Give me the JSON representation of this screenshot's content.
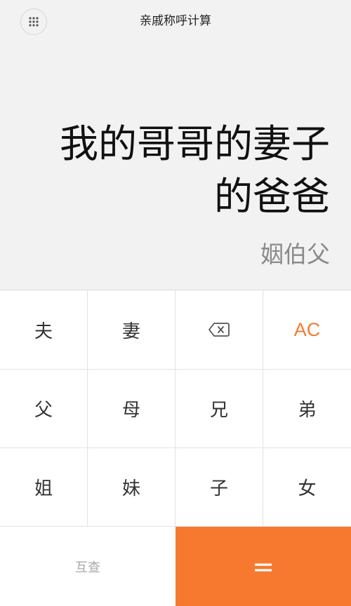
{
  "header": {
    "title": "亲戚称呼计算",
    "menu_icon": "grid-dots-icon"
  },
  "display": {
    "expression_line1": "我的哥哥的妻子",
    "expression_line2": "的爸爸",
    "result": "姻伯父"
  },
  "keypad": {
    "row1": [
      "夫",
      "妻",
      "",
      "AC"
    ],
    "row2": [
      "父",
      "母",
      "兄",
      "弟"
    ],
    "row3": [
      "姐",
      "妹",
      "子",
      "女"
    ],
    "mutual_label": "互查",
    "equals_label": "=",
    "backspace_icon": "backspace-icon"
  },
  "colors": {
    "accent": "#f77930",
    "ac_text": "#f37b2e",
    "display_bg": "#f2f2f2"
  }
}
